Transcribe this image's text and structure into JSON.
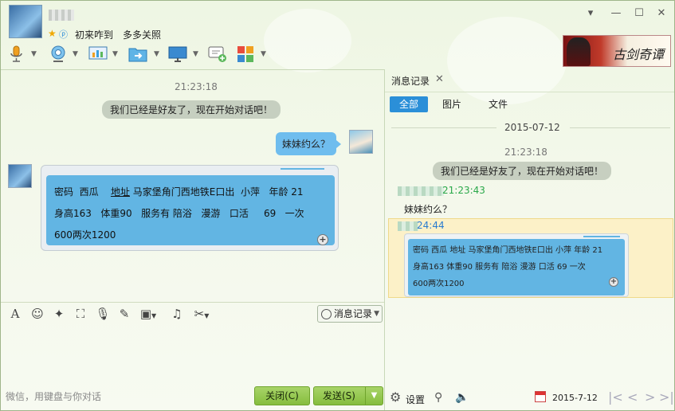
{
  "header": {
    "signature_parts": [
      "初来咋到",
      "多多关照"
    ]
  },
  "chat": {
    "timestamp": "21:23:18",
    "system_message": "我们已经是好友了，现在开始对话吧！",
    "self_message": "妹妹约么？",
    "card_lines": [
      [
        "密码",
        "西瓜",
        "地址",
        "马家堡角门西地铁E口出",
        "小萍",
        "年龄 21"
      ],
      [
        "身高163",
        "体重90",
        "服务有 陪浴",
        "漫游",
        "口活",
        "69",
        "一次"
      ],
      [
        "600两次1200"
      ]
    ]
  },
  "input": {
    "history_label": "消息记录",
    "hint": "微信，用键盘与你对话",
    "close_label": "关闭(C)",
    "send_label": "发送(S)"
  },
  "history": {
    "tab_label": "消息记录",
    "filters": [
      "全部",
      "图片",
      "文件"
    ],
    "date": "2015-07-12",
    "time1": "21:23:18",
    "system_message": "我们已经是好友了，现在开始对话吧！",
    "time2": "21:23:43",
    "self_message": "妹妹约么？",
    "time3": "24:44",
    "card_lines": [
      "密码  西瓜     地址  马家堡角门西地铁E口出  小萍    年龄 21",
      "身高163   体重90   服务有 陪浴    漫游    口活     69     一次",
      "600两次1200"
    ],
    "settings_label": "设置",
    "bottom_date": "2015-7-12"
  },
  "colors": {
    "accent_blue": "#2b8fd8",
    "bubble_blue": "#62b5e3",
    "send_green": "#86bd3e"
  }
}
